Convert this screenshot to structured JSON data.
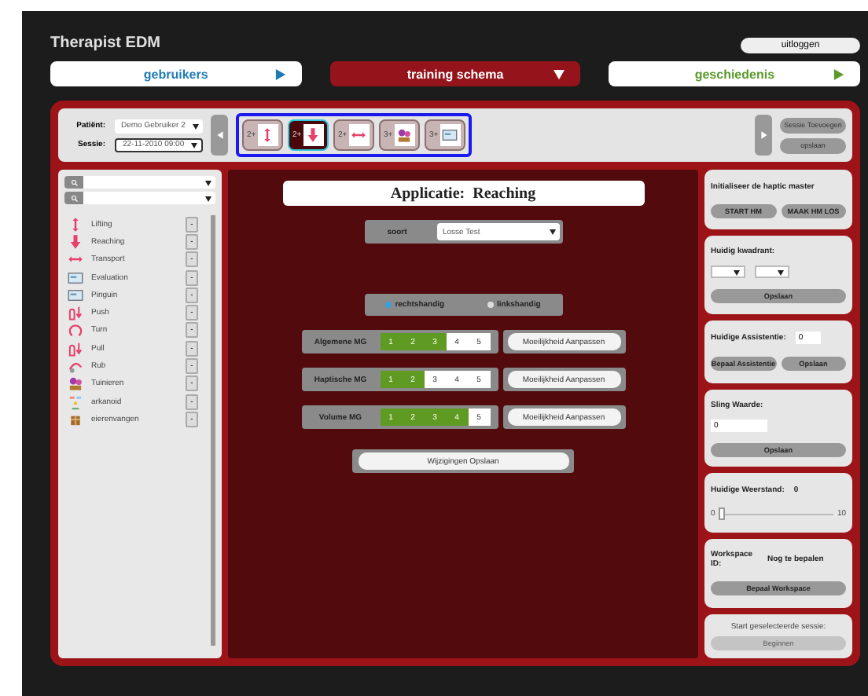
{
  "window": {
    "title": "Therapist EDM"
  },
  "logout": "uitloggen",
  "nav": [
    {
      "label": "gebruikers",
      "selected": false,
      "color": "#1f7ab5"
    },
    {
      "label": "training schema",
      "selected": true,
      "color": "#ffffff"
    },
    {
      "label": "geschiedenis",
      "selected": false,
      "color": "#5a9a2a"
    }
  ],
  "session": {
    "patient_label": "Patiënt:",
    "patient": "Demo Gebruiker 2",
    "session_label": "Sessie:",
    "session": "22-11-2010  09:00",
    "add_button": "Sessie Toevoegen",
    "save_button": "opslaan"
  },
  "exercises": [
    {
      "count": "2+",
      "kind": "updown",
      "selected": false
    },
    {
      "count": "2+",
      "kind": "down",
      "selected": true
    },
    {
      "count": "2+",
      "kind": "leftright",
      "selected": false
    },
    {
      "count": "3+",
      "kind": "plant",
      "selected": false
    },
    {
      "count": "3+",
      "kind": "screen",
      "selected": false
    }
  ],
  "apps": [
    {
      "name": "Lifting",
      "kind": "updown",
      "button": "-"
    },
    {
      "name": "Reaching",
      "kind": "down",
      "button": "-"
    },
    {
      "name": "Transport",
      "kind": "leftright",
      "button": "-"
    },
    {
      "name": "Evaluation",
      "kind": "screen",
      "button": "-"
    },
    {
      "name": "Pinguin",
      "kind": "screen",
      "button": "-"
    },
    {
      "name": "Push",
      "kind": "hand",
      "button": "-"
    },
    {
      "name": "Turn",
      "kind": "turn",
      "button": "-"
    },
    {
      "name": "Pull",
      "kind": "hand",
      "button": "-"
    },
    {
      "name": "Rub",
      "kind": "rub",
      "button": "-"
    },
    {
      "name": "Tuinieren",
      "kind": "plant",
      "button": "-"
    },
    {
      "name": "arkanoid",
      "kind": "blocks",
      "button": "-"
    },
    {
      "name": "eierenvangen",
      "kind": "basket",
      "button": "-"
    }
  ],
  "detail": {
    "title": "Applicatie:  Reaching",
    "type_label": "soort",
    "type_value": "Losse Test",
    "hands": [
      {
        "label": "rechtshandig",
        "selected": true
      },
      {
        "label": "linkshandig",
        "selected": false
      }
    ],
    "levels": [
      {
        "name": "Algemene MG",
        "button": "Moeilijkheid Aanpassen",
        "steps": [
          {
            "label": "1",
            "on": true
          },
          {
            "label": "2",
            "on": true
          },
          {
            "label": "3",
            "on": true
          },
          {
            "label": "4",
            "on": false
          },
          {
            "label": "5",
            "on": false
          }
        ]
      },
      {
        "name": "Haptische MG",
        "button": "Moeilijkheid Aanpassen",
        "steps": [
          {
            "label": "1",
            "on": true
          },
          {
            "label": "2",
            "on": true
          },
          {
            "label": "3",
            "on": false
          },
          {
            "label": "4",
            "on": false
          },
          {
            "label": "5",
            "on": false
          }
        ]
      },
      {
        "name": "Volume MG",
        "button": "Moeilijkheid Aanpassen",
        "steps": [
          {
            "label": "1",
            "on": true
          },
          {
            "label": "2",
            "on": true
          },
          {
            "label": "3",
            "on": true
          },
          {
            "label": "4",
            "on": true
          },
          {
            "label": "5",
            "on": false
          }
        ]
      }
    ],
    "save_button": "Wijzigingen Opslaan"
  },
  "haptic": {
    "title": "Initialiseer de haptic master",
    "buttons": [
      "START HM",
      "MAAK HM LOS"
    ]
  },
  "quadrant": {
    "label": "Huidig kwadrant:",
    "button": "Opslaan"
  },
  "assist": {
    "label": "Huidige Assistentie:",
    "value": "0",
    "buttons": [
      "Bepaal Assistentie",
      "Opslaan"
    ]
  },
  "sling": {
    "label": "Sling Waarde:",
    "value": "0",
    "button": "Opslaan"
  },
  "resistance": {
    "label": "Huidige Weerstand:",
    "value": "0",
    "level": 0,
    "min": "0",
    "max": "10"
  },
  "workspace": {
    "label": "Workspace ID:",
    "value": "Nog te bepalen",
    "button": "Bepaal Workspace"
  },
  "start": {
    "label": "Start geselecteerde sessie:",
    "button": "Beginnen",
    "disabled": true
  }
}
